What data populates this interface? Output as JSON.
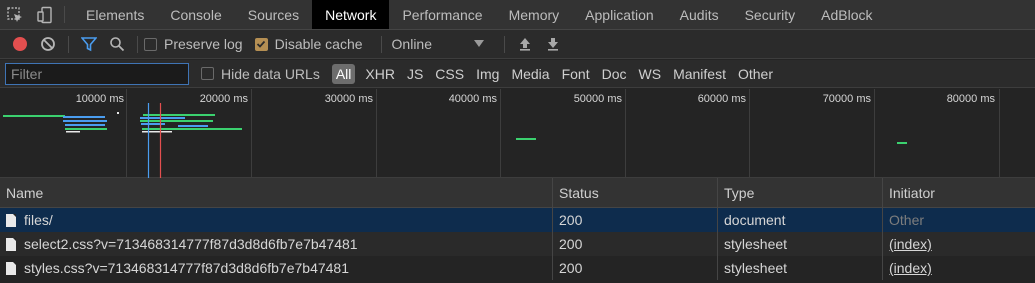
{
  "tabs": [
    "Elements",
    "Console",
    "Sources",
    "Network",
    "Performance",
    "Memory",
    "Application",
    "Audits",
    "Security",
    "AdBlock"
  ],
  "active_tab": "Network",
  "toolbar": {
    "preserve_log": "Preserve log",
    "disable_cache": "Disable cache",
    "throttle": "Online",
    "preserve_log_checked": false,
    "disable_cache_checked": true
  },
  "filter": {
    "placeholder": "Filter",
    "value": "",
    "hide_data_urls": "Hide data URLs",
    "types": [
      "All",
      "XHR",
      "JS",
      "CSS",
      "Img",
      "Media",
      "Font",
      "Doc",
      "WS",
      "Manifest",
      "Other"
    ],
    "active_type": "All"
  },
  "overview": {
    "ticks": [
      "10000 ms",
      "20000 ms",
      "30000 ms",
      "40000 ms",
      "50000 ms",
      "60000 ms",
      "70000 ms",
      "80000 ms"
    ]
  },
  "columns": [
    "Name",
    "Status",
    "Type",
    "Initiator"
  ],
  "rows": [
    {
      "name": "files/",
      "status": "200",
      "type": "document",
      "initiator": "Other"
    },
    {
      "name": "select2.css?v=713468314777f87d3d8d6fb7e7b47481",
      "status": "200",
      "type": "stylesheet",
      "initiator": "(index)"
    },
    {
      "name": "styles.css?v=713468314777f87d3d8d6fb7e7b47481",
      "status": "200",
      "type": "stylesheet",
      "initiator": "(index)"
    }
  ],
  "colors": {
    "accent_blue": "#3f74b5",
    "record_red": "#e34f4f",
    "bar_green": "#3bd16f",
    "bar_blue": "#4a9df0",
    "selected_row": "#0e2c4d"
  }
}
